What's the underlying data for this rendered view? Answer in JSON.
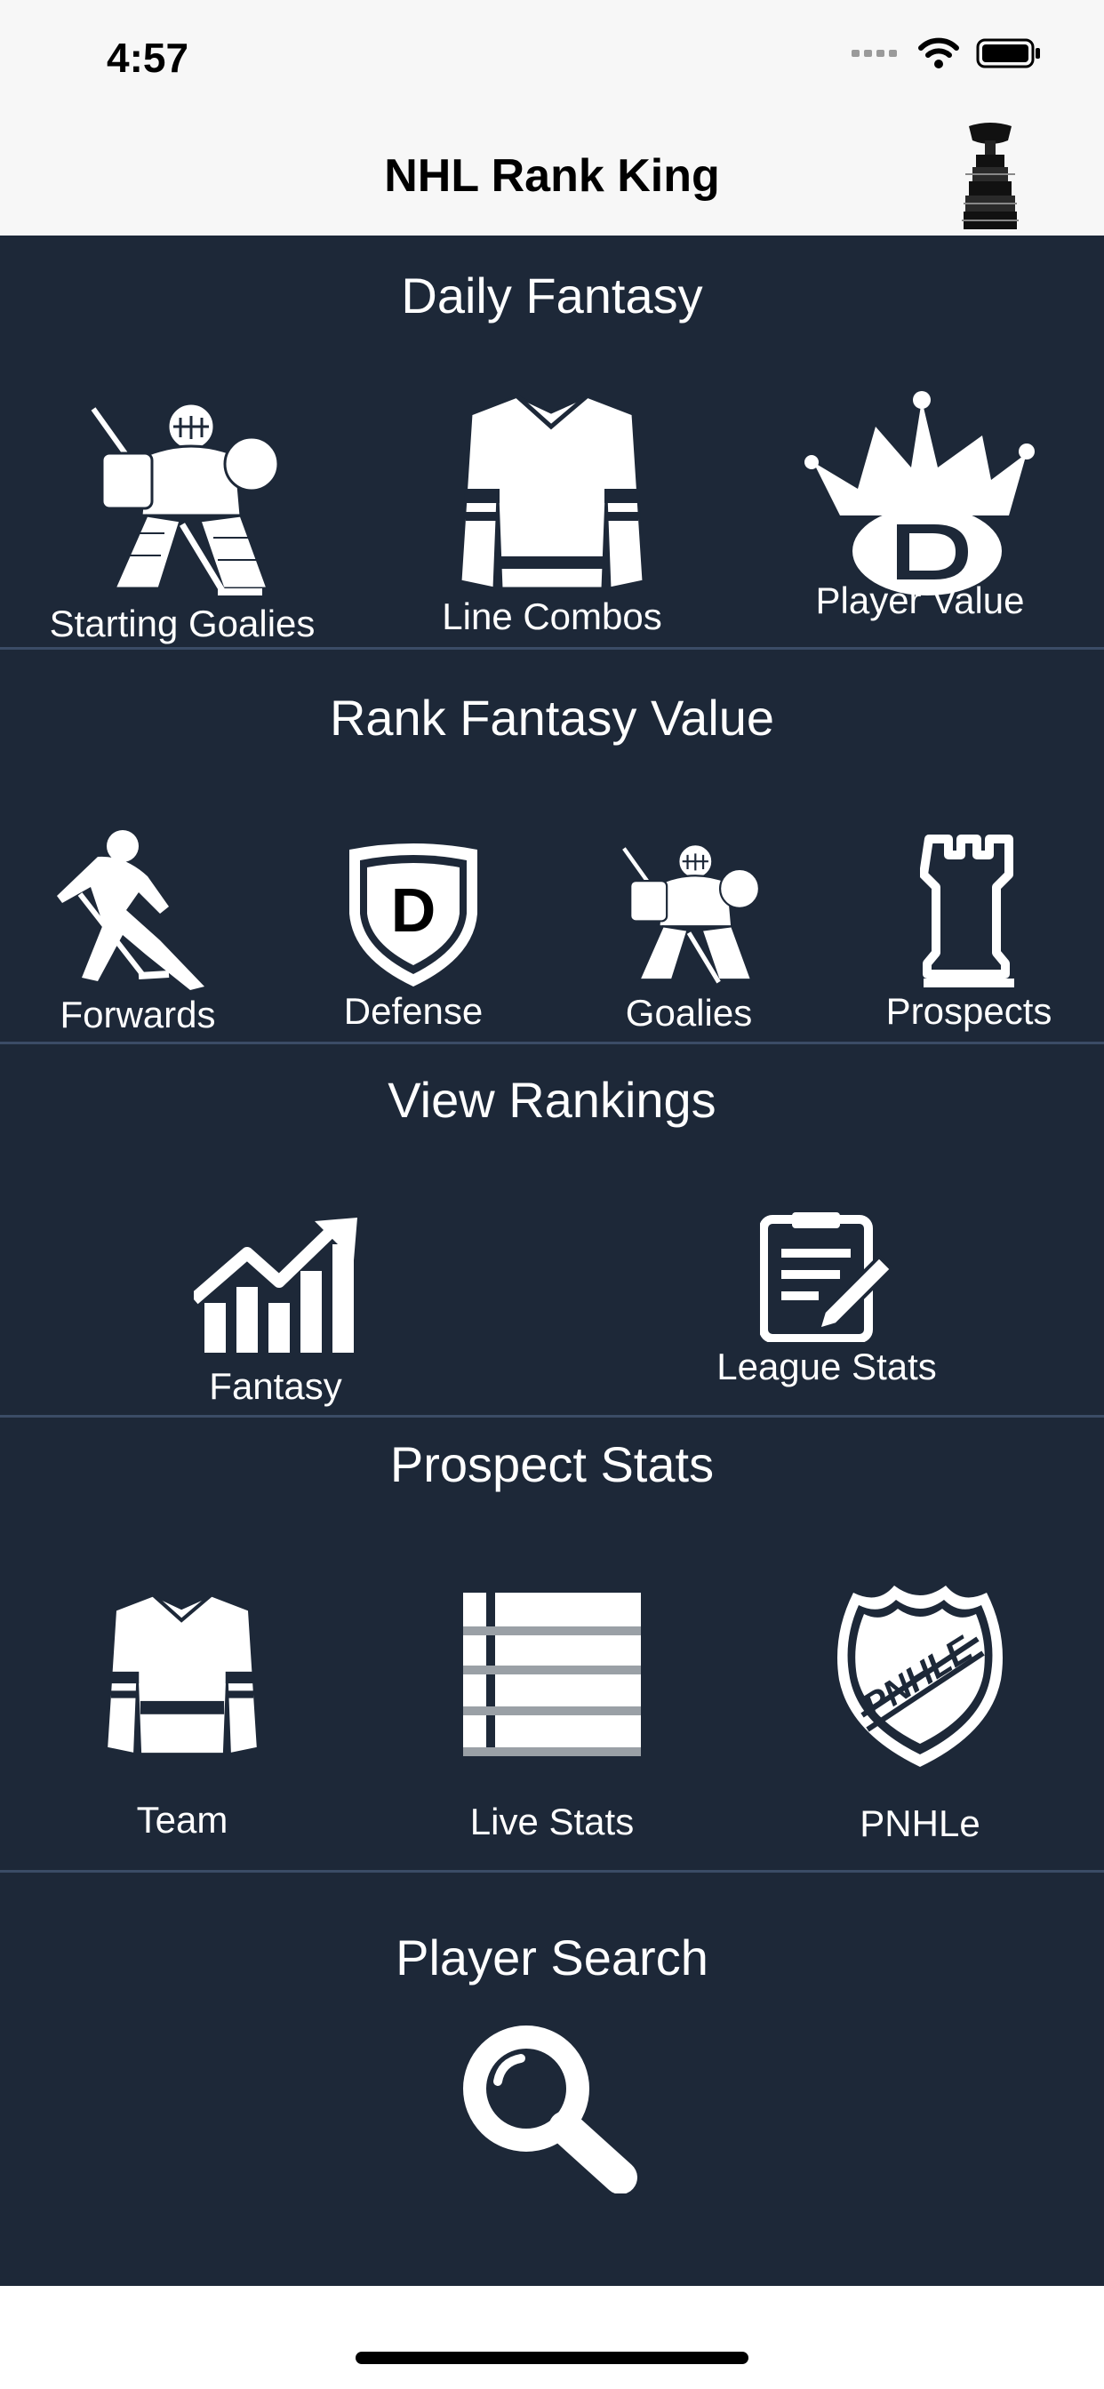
{
  "status_bar": {
    "time": "4:57"
  },
  "nav": {
    "title": "NHL Rank King",
    "icon": "stanley-cup-icon"
  },
  "sections": {
    "daily_fantasy": {
      "title": "Daily Fantasy",
      "items": [
        {
          "label": "Starting Goalies",
          "icon": "goalie-icon"
        },
        {
          "label": "Line Combos",
          "icon": "jersey-icon"
        },
        {
          "label": "Player Value",
          "icon": "draftkings-crown-icon"
        }
      ]
    },
    "rank_fantasy_value": {
      "title": "Rank Fantasy Value",
      "items": [
        {
          "label": "Forwards",
          "icon": "skater-icon"
        },
        {
          "label": "Defense",
          "icon": "defense-shield-icon",
          "badge": "D"
        },
        {
          "label": "Goalies",
          "icon": "goalie-icon"
        },
        {
          "label": "Prospects",
          "icon": "chess-rook-icon"
        }
      ]
    },
    "view_rankings": {
      "title": "View Rankings",
      "items": [
        {
          "label": "Fantasy",
          "icon": "bar-chart-trend-icon"
        },
        {
          "label": "League Stats",
          "icon": "clipboard-edit-icon"
        }
      ]
    },
    "prospect_stats": {
      "title": "Prospect Stats",
      "items": [
        {
          "label": "Team",
          "icon": "jersey-icon"
        },
        {
          "label": "Live Stats",
          "icon": "list-icon"
        },
        {
          "label": "PNHLe",
          "icon": "pnhle-shield-icon",
          "badge": "PNHLE"
        }
      ]
    },
    "player_search": {
      "title": "Player Search",
      "icon": "search-icon"
    }
  }
}
